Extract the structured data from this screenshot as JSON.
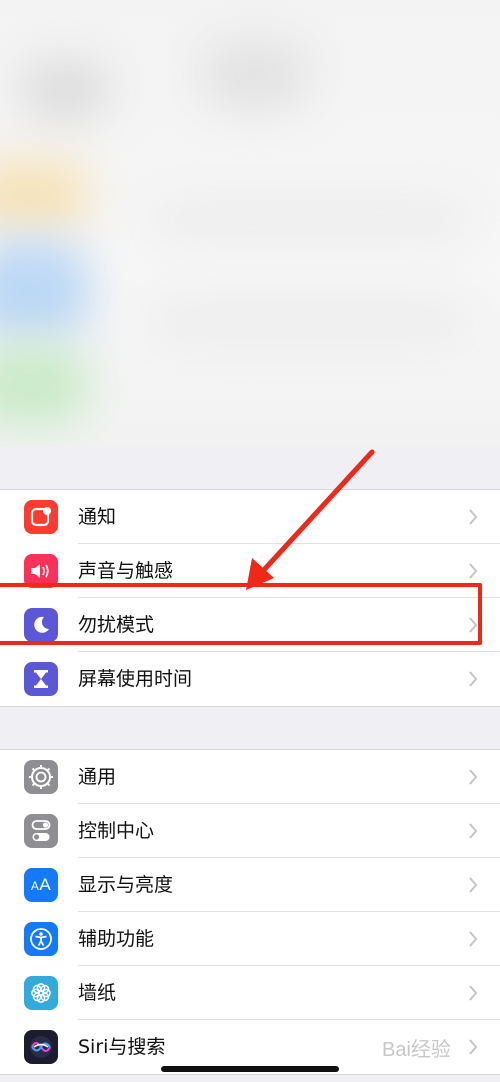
{
  "groups": [
    {
      "items": [
        {
          "label": "通知",
          "icon": "notifications-icon",
          "color": "#fd3b30"
        },
        {
          "label": "声音与触感",
          "icon": "sound-icon",
          "color": "#fc3159"
        },
        {
          "label": "勿扰模式",
          "icon": "moon-icon",
          "color": "#5b57d6"
        },
        {
          "label": "屏幕使用时间",
          "icon": "hourglass-icon",
          "color": "#5b57d6"
        }
      ]
    },
    {
      "items": [
        {
          "label": "通用",
          "icon": "gear-icon",
          "color": "#8e8e93"
        },
        {
          "label": "控制中心",
          "icon": "toggles-icon",
          "color": "#8e8e93"
        },
        {
          "label": "显示与亮度",
          "icon": "text-size-icon",
          "color": "#1579fc"
        },
        {
          "label": "辅助功能",
          "icon": "accessibility-icon",
          "color": "#1579fc"
        },
        {
          "label": "墙纸",
          "icon": "flower-icon",
          "color": "#33aadc"
        },
        {
          "label": "Siri与搜索",
          "icon": "siri-icon",
          "color": "#1c1c2e"
        }
      ]
    }
  ],
  "annotation": {
    "color": "#f02818",
    "highlighted_item": "勿扰模式"
  },
  "watermark": "Bai经验"
}
